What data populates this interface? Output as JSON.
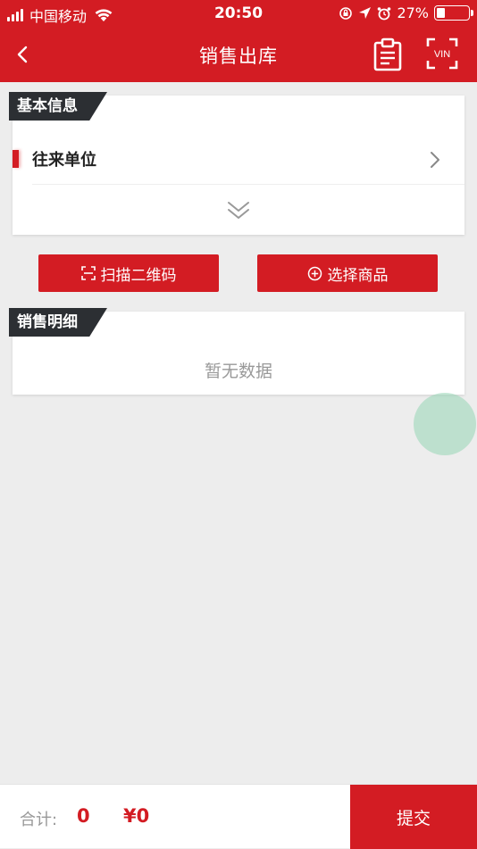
{
  "status_bar": {
    "carrier": "中国移动",
    "time": "20:50",
    "battery": "27%",
    "battery_level": 0.27
  },
  "header": {
    "title": "销售出库",
    "scan_vin_label": "VIN",
    "back_icon": "back-icon",
    "doc_icon": "document-icon"
  },
  "basic_info": {
    "section_title": "基本信息",
    "field_label": "往来单位"
  },
  "actions": {
    "scan_label": "扫描二维码",
    "select_label": "选择商品"
  },
  "detail": {
    "section_title": "销售明细",
    "empty_text": "暂无数据"
  },
  "footer": {
    "total_label": "合计:",
    "total_qty": "0",
    "total_amount": "¥0",
    "submit_label": "提交"
  },
  "colors": {
    "primary": "#d31c23",
    "dark_tag": "#2c2f33",
    "background": "#ededed"
  }
}
